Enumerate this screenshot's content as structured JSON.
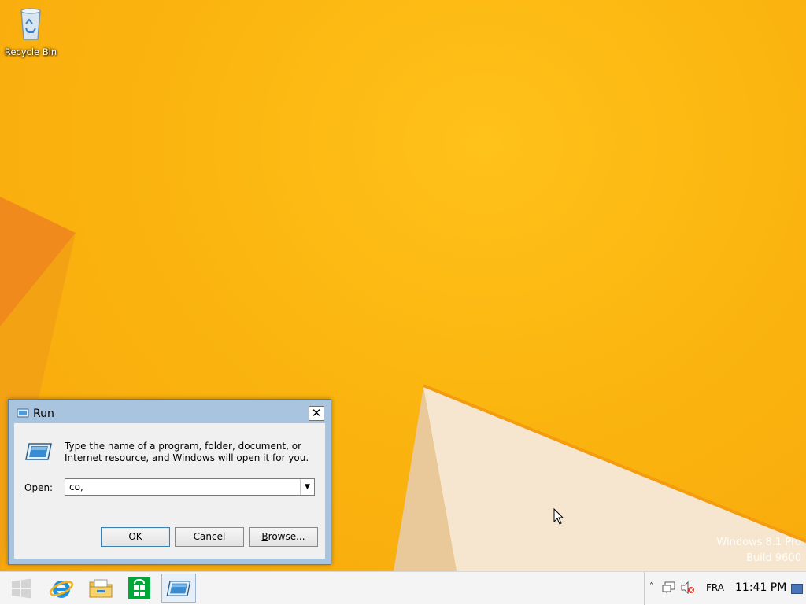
{
  "desktop": {
    "icons": [
      {
        "label": "Recycle Bin",
        "icon": "recycle-bin-icon"
      }
    ],
    "watermark": {
      "line1": "Windows 8.1 Pro",
      "line2": "Build 9600"
    }
  },
  "run_dialog": {
    "title": "Run",
    "close_label": "✕",
    "description": "Type the name of a program, folder, document, or Internet resource, and Windows will open it for you.",
    "open_label_accel": "O",
    "open_label_rest": "pen:",
    "open_value": "co,",
    "buttons": {
      "ok": "OK",
      "cancel": "Cancel",
      "browse_accel": "B",
      "browse_rest": "rowse..."
    }
  },
  "taskbar": {
    "items": [
      {
        "name": "start",
        "icon": "windows-logo-icon"
      },
      {
        "name": "internet-explorer",
        "icon": "internet-explorer-icon"
      },
      {
        "name": "file-explorer",
        "icon": "folder-icon"
      },
      {
        "name": "store",
        "icon": "store-icon"
      },
      {
        "name": "run",
        "icon": "run-icon",
        "active": true
      }
    ],
    "tray": {
      "chevron": "˄",
      "language": "FRA",
      "time": "11:41 PM"
    }
  },
  "colors": {
    "desktop_yellow": "#fbb50f",
    "desktop_orange": "#f08a1c",
    "dialog_frame": "#a8c4df",
    "taskbar": "#f4f4f4"
  }
}
